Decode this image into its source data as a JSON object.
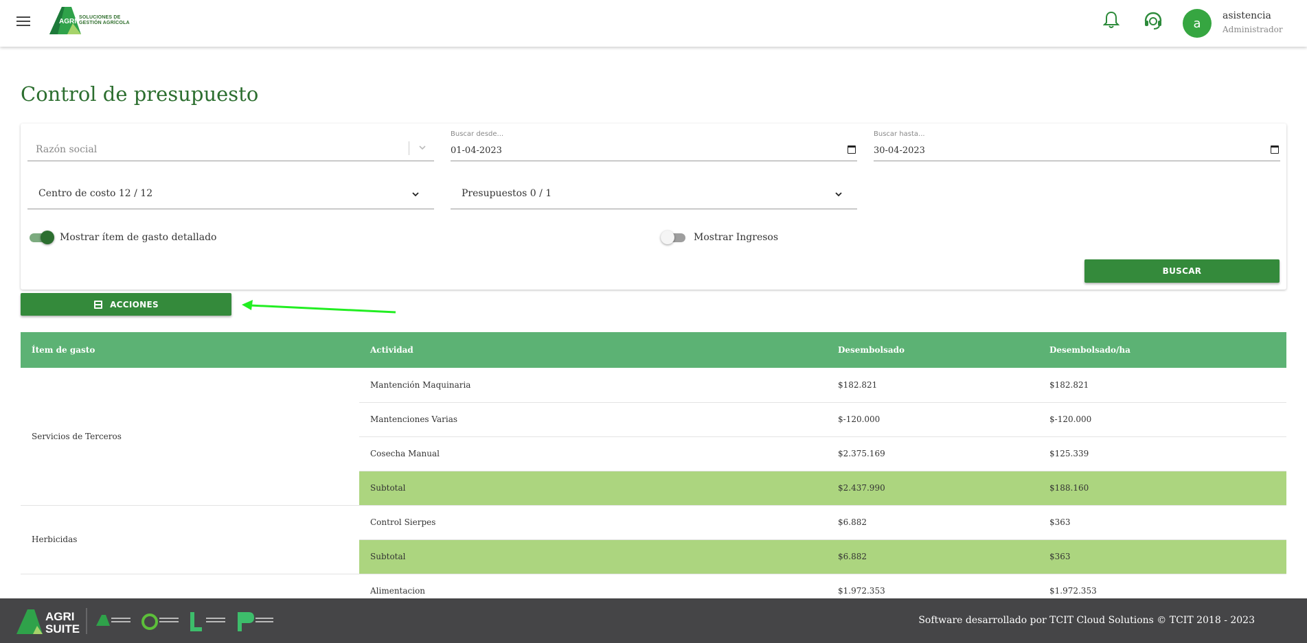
{
  "header": {
    "logo_word": "AGRI",
    "logo_tagline_1": "SOLUCIONES DE",
    "logo_tagline_2": "GESTIÓN AGRÍCOLA",
    "avatar_letter": "a",
    "user_name": "asistencia",
    "user_role": "Administrador",
    "icons": [
      "menu-icon",
      "bell-icon",
      "support-agent-icon"
    ]
  },
  "page": {
    "title": "Control de presupuesto"
  },
  "filters": {
    "razon_social_placeholder": "Razón social",
    "desde_label": "Buscar desde...",
    "desde_value": "01-04-2023",
    "hasta_label": "Buscar hasta...",
    "hasta_value": "30-04-2023",
    "centro_costo": "Centro de costo 12 / 12",
    "presupuestos": "Presupuestos 0 / 1",
    "toggle_detalle_label": "Mostrar ítem de gasto detallado",
    "toggle_detalle_on": true,
    "toggle_ingresos_label": "Mostrar Ingresos",
    "toggle_ingresos_on": false,
    "buscar_label": "BUSCAR"
  },
  "actions": {
    "acciones_label": "ACCIONES"
  },
  "table": {
    "headers": [
      "Ítem de gasto",
      "Actividad",
      "Desembolsado",
      "Desembolsado/ha"
    ],
    "groups": [
      {
        "item": "Servicios de Terceros",
        "rows": [
          {
            "actividad": "Mantención Maquinaria",
            "desembolsado": "$182.821",
            "por_ha": "$182.821"
          },
          {
            "actividad": "Mantenciones Varias",
            "desembolsado": "$-120.000",
            "por_ha": "$-120.000"
          },
          {
            "actividad": "Cosecha Manual",
            "desembolsado": "$2.375.169",
            "por_ha": "$125.339"
          }
        ],
        "subtotal": {
          "label": "Subtotal",
          "desembolsado": "$2.437.990",
          "por_ha": "$188.160"
        }
      },
      {
        "item": "Herbicidas",
        "rows": [
          {
            "actividad": "Control Sierpes",
            "desembolsado": "$6.882",
            "por_ha": "$363"
          }
        ],
        "subtotal": {
          "label": "Subtotal",
          "desembolsado": "$6.882",
          "por_ha": "$363"
        }
      },
      {
        "item": "",
        "rows": [
          {
            "actividad": "Alimentacion",
            "desembolsado": "$1.972.353",
            "por_ha": "$1.972.353"
          }
        ]
      }
    ],
    "colors": {
      "header_bg": "#5cb274",
      "subtotal_bg": "#acd57f"
    }
  },
  "footer": {
    "brand_1": "AGRI",
    "brand_2": "SUITE",
    "text": "Software desarrollado por TCIT Cloud Solutions © TCIT 2018 - 2023"
  },
  "colors": {
    "primary": "#348a3b",
    "title": "#2c6e2f",
    "footer_bg": "#454547",
    "arrow": "#22ee22"
  }
}
